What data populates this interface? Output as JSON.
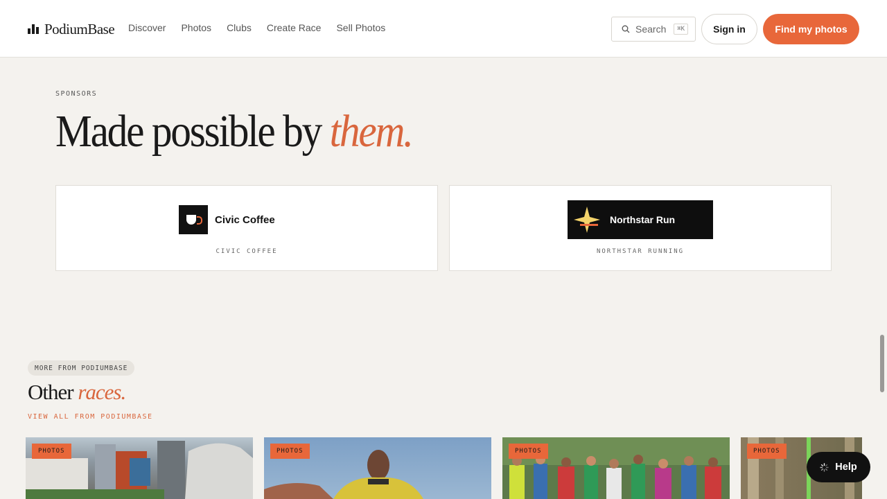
{
  "header": {
    "brand": "PodiumBase",
    "nav": [
      "Discover",
      "Photos",
      "Clubs",
      "Create Race",
      "Sell Photos"
    ],
    "search": {
      "label": "Search",
      "shortcut": "⌘K"
    },
    "signin_label": "Sign in",
    "cta_label": "Find my photos"
  },
  "sponsors": {
    "eyebrow": "SPONSORS",
    "title_main": "Made possible by ",
    "title_accent": "them.",
    "cards": [
      {
        "logo_text": "Civic Coffee",
        "name": "CIVIC COFFEE"
      },
      {
        "logo_text": "Northstar Run",
        "name": "NORTHSTAR RUNNING"
      }
    ]
  },
  "other_races": {
    "pill": "MORE FROM PODIUMBASE",
    "title_main": "Other ",
    "title_accent": "races.",
    "view_all": "VIEW ALL FROM PODIUMBASE",
    "cards": [
      {
        "badge": "PHOTOS"
      },
      {
        "badge": "PHOTOS"
      },
      {
        "badge": "PHOTOS"
      },
      {
        "badge": "PHOTOS"
      }
    ]
  },
  "help_label": "Help",
  "colors": {
    "accent": "#e8673a",
    "background": "#f4f2ee",
    "ink": "#1a1a1a"
  }
}
